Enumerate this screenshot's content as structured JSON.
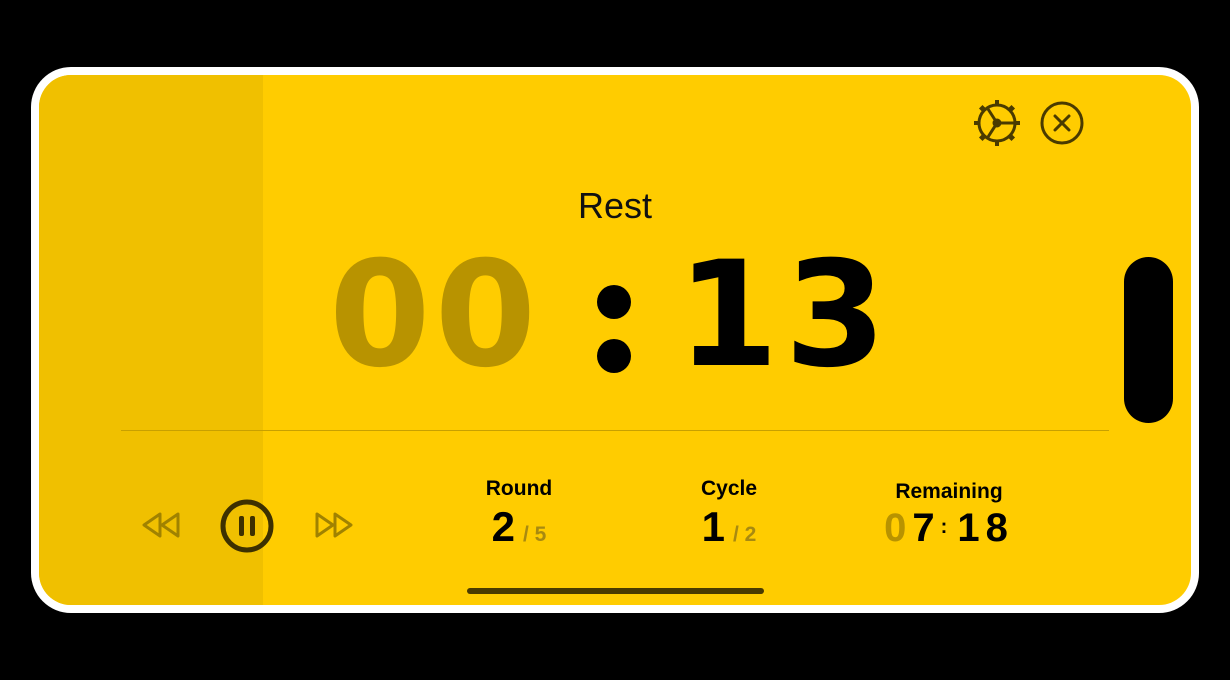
{
  "phase": {
    "label": "Rest"
  },
  "timer": {
    "minutes": "00",
    "seconds": "13"
  },
  "stats": {
    "round": {
      "label": "Round",
      "current": "2",
      "total": "/ 5"
    },
    "cycle": {
      "label": "Cycle",
      "current": "1",
      "total": "/ 2"
    },
    "remaining": {
      "label": "Remaining",
      "minutes_dim": "0",
      "minutes": "7",
      "separator": ":",
      "seconds": "18"
    }
  },
  "icons": {
    "settings": "gear-icon",
    "close": "close-circle-icon",
    "rewind": "rewind-icon",
    "pause": "pause-icon",
    "forward": "fast-forward-icon"
  },
  "colors": {
    "background": "#ffcc00",
    "side_panel": "#f0c000",
    "elapsed_dim": "#b89300",
    "text": "#000000",
    "icon": "#4a3b00"
  }
}
